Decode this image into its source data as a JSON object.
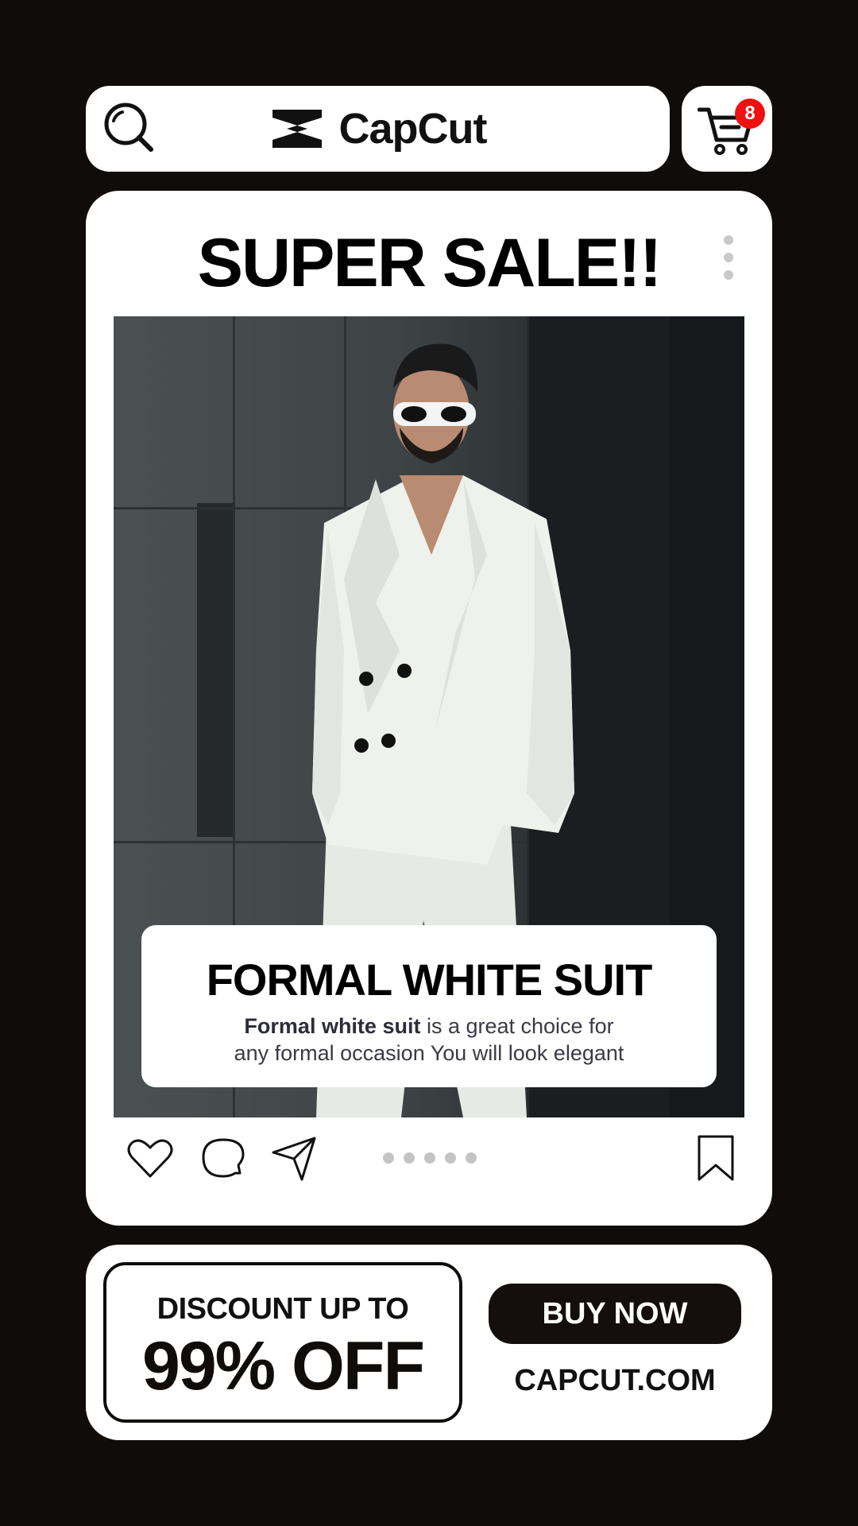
{
  "header": {
    "brand_name": "CapCut",
    "search_icon": "search-icon",
    "logo_icon": "capcut-logo-icon",
    "cart_icon": "cart-icon",
    "cart_count": "8"
  },
  "post": {
    "title": "SUPER SALE!!",
    "more_icon": "more-vertical-icon",
    "product_title": "FORMAL WHITE SUIT",
    "description_bold": "Formal white suit",
    "description_line1_rest": " is a great choice for",
    "description_line2": "any formal occasion You will look elegant",
    "actions": [
      "heart-icon",
      "comment-icon",
      "share-icon",
      "bookmark-icon"
    ],
    "carousel_dots": 5
  },
  "promo": {
    "discount_label": "DISCOUNT UP TO",
    "discount_value": "99% OFF",
    "cta_label": "BUY NOW",
    "site_url": "CAPCUT.COM"
  },
  "colors": {
    "background": "#0f0c0a",
    "card": "#ffffff",
    "badge": "#ef1010",
    "dots": "#c4c4c4"
  }
}
